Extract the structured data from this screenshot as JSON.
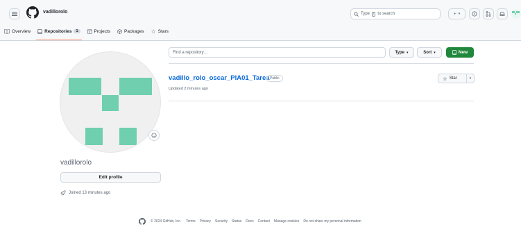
{
  "header": {
    "username": "vadillorolo",
    "search_prefix": "Type",
    "search_key": "/",
    "search_suffix": "to search",
    "plus_label": "+",
    "caret": "▾"
  },
  "tabs": [
    {
      "label": "Overview"
    },
    {
      "label": "Repositories",
      "count": "1"
    },
    {
      "label": "Projects"
    },
    {
      "label": "Packages"
    },
    {
      "label": "Stars"
    }
  ],
  "profile": {
    "nickname": "vadillorolo",
    "edit_label": "Edit profile",
    "joined": "Joined 13 minutes ago"
  },
  "repos": {
    "find_placeholder": "Find a repository…",
    "type_label": "Type",
    "sort_label": "Sort",
    "new_label": "New",
    "items": [
      {
        "name": "vadillo_rolo_oscar_PIA01_Tarea",
        "visibility": "Public",
        "updated": "Updated 2 minutes ago",
        "star_label": "Star"
      }
    ]
  },
  "footer": {
    "copyright": "© 2024 GitHub, Inc.",
    "links": [
      "Terms",
      "Privacy",
      "Security",
      "Status",
      "Docs",
      "Contact",
      "Manage cookies",
      "Do not share my personal information"
    ]
  },
  "colors": {
    "accent_green": "#1f883d",
    "link_blue": "#0969da",
    "tab_underline": "#fd8c73",
    "avatar_pixel": "#6fcfaf"
  }
}
